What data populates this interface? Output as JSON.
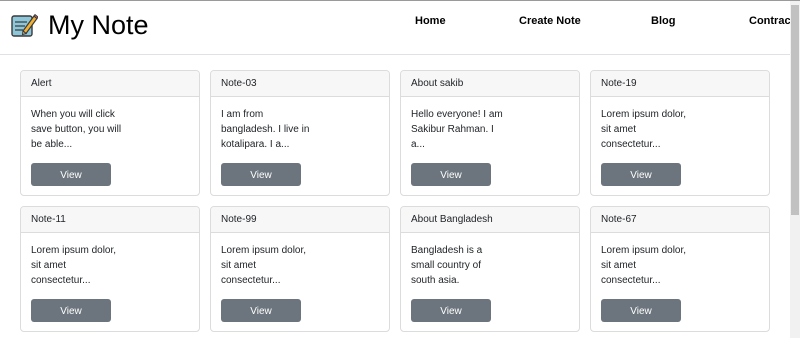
{
  "brand": {
    "title": "My Note",
    "icon": "notepad-pencil-icon"
  },
  "nav": {
    "home": "Home",
    "create_note": "Create Note",
    "blog": "Blog",
    "contract": "Contract"
  },
  "colors": {
    "button_bg": "#6c757d",
    "card_header_bg": "#f7f7f7"
  },
  "cards": [
    {
      "title": "Alert",
      "text": "When you will click save button, you will be able...",
      "button": "View"
    },
    {
      "title": "Note-03",
      "text": "I am from bangladesh. I live in kotalipara. I a...",
      "button": "View"
    },
    {
      "title": "About sakib",
      "text": "Hello everyone! I am Sakibur Rahman. I a...",
      "button": "View"
    },
    {
      "title": "Note-19",
      "text": "Lorem ipsum dolor, sit amet consectetur...",
      "button": "View"
    },
    {
      "title": "Note-11",
      "text": "Lorem ipsum dolor, sit amet consectetur...",
      "button": "View"
    },
    {
      "title": "Note-99",
      "text": "Lorem ipsum dolor, sit amet consectetur...",
      "button": "View"
    },
    {
      "title": "About Bangladesh",
      "text": "Bangladesh is a small country of south asia.",
      "button": "View"
    },
    {
      "title": "Note-67",
      "text": "Lorem ipsum dolor, sit amet consectetur...",
      "button": "View"
    }
  ]
}
